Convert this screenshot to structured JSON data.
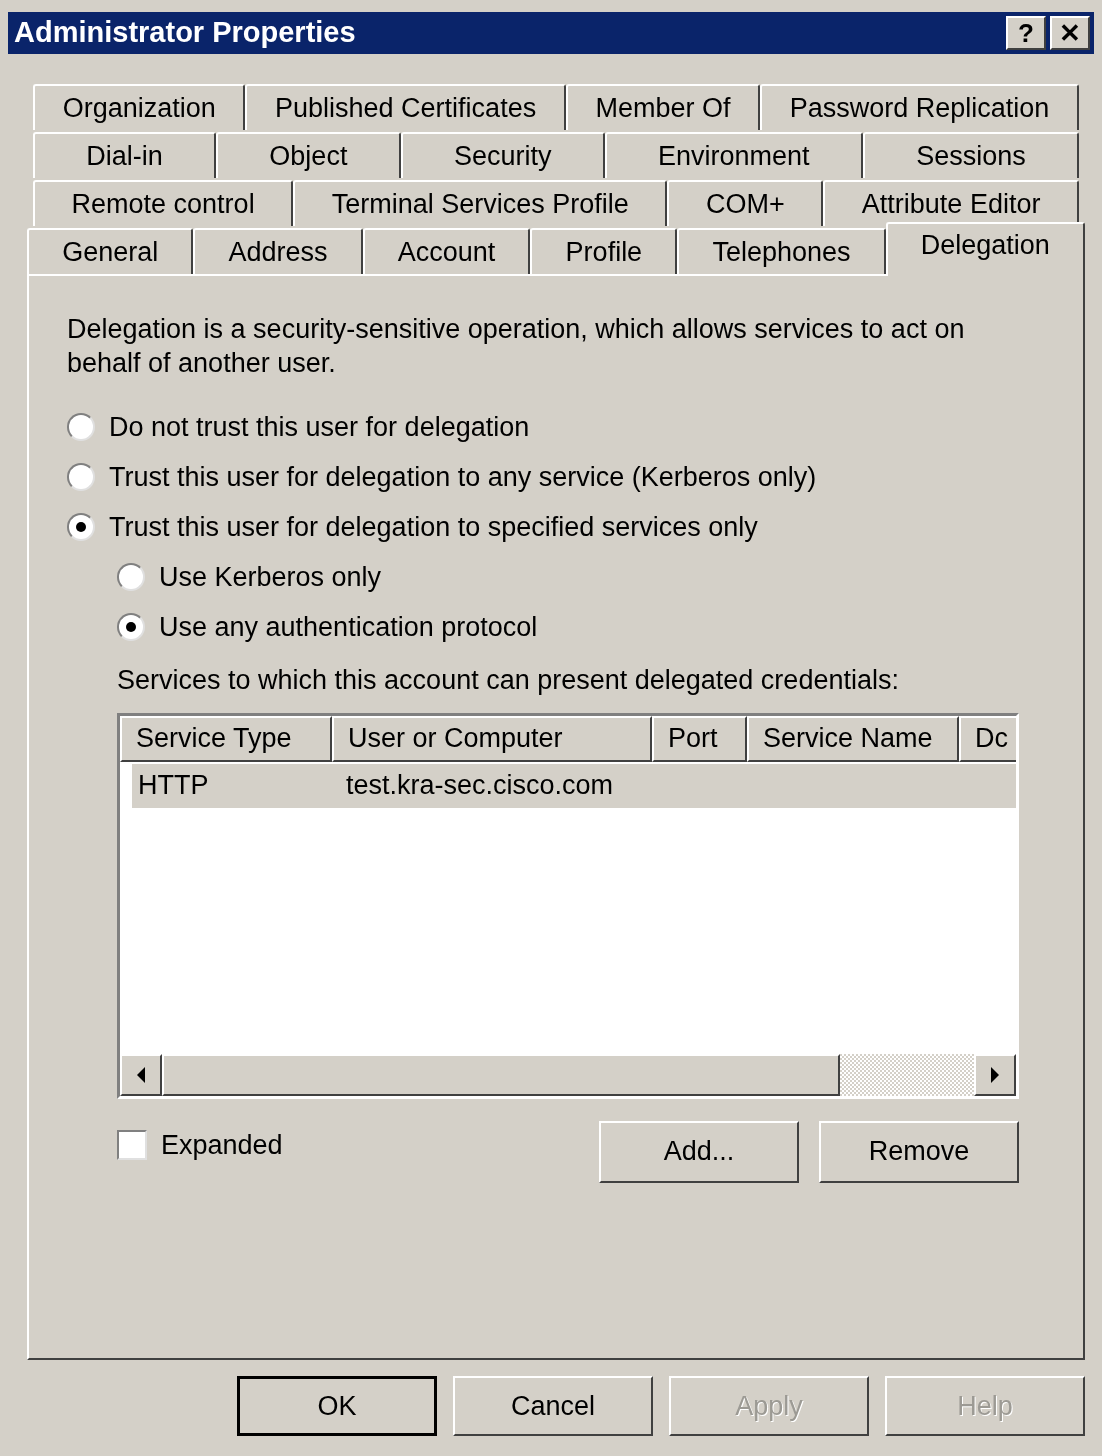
{
  "window": {
    "title": "Administrator Properties",
    "controls": [
      "?",
      "✕"
    ]
  },
  "tab_rows": [
    [
      {
        "label": "Organization",
        "selected": false
      },
      {
        "label": "Published Certificates",
        "selected": false
      },
      {
        "label": "Member Of",
        "selected": false
      },
      {
        "label": "Password Replication",
        "selected": false
      }
    ],
    [
      {
        "label": "Dial-in",
        "selected": false
      },
      {
        "label": "Object",
        "selected": false
      },
      {
        "label": "Security",
        "selected": false
      },
      {
        "label": "Environment",
        "selected": false
      },
      {
        "label": "Sessions",
        "selected": false
      }
    ],
    [
      {
        "label": "Remote control",
        "selected": false
      },
      {
        "label": "Terminal Services Profile",
        "selected": false
      },
      {
        "label": "COM+",
        "selected": false
      },
      {
        "label": "Attribute Editor",
        "selected": false
      }
    ],
    [
      {
        "label": "General",
        "selected": false
      },
      {
        "label": "Address",
        "selected": false
      },
      {
        "label": "Account",
        "selected": false
      },
      {
        "label": "Profile",
        "selected": false
      },
      {
        "label": "Telephones",
        "selected": false
      },
      {
        "label": "Delegation",
        "selected": true
      }
    ]
  ],
  "description": "Delegation is a security-sensitive operation, which allows services to act on behalf of another user.",
  "delegation_options": [
    {
      "label": "Do not trust this user for delegation",
      "selected": false
    },
    {
      "label": "Trust this user for delegation to any service (Kerberos only)",
      "selected": false
    },
    {
      "label": "Trust this user for delegation to specified services only",
      "selected": true,
      "children": [
        {
          "label": "Use Kerberos only",
          "selected": false
        },
        {
          "label": "Use any authentication protocol",
          "selected": true
        }
      ]
    }
  ],
  "services_label": "Services to which this account can present delegated credentials:",
  "table": {
    "columns": [
      "Service Type",
      "User or Computer",
      "Port",
      "Service Name",
      "Dc"
    ],
    "rows": [
      {
        "cells": [
          "HTTP",
          "test.kra-sec.cisco.com"
        ],
        "selected": true
      }
    ]
  },
  "expanded": {
    "label": "Expanded",
    "checked": false
  },
  "list_buttons": [
    {
      "label": "Add...",
      "disabled": false
    },
    {
      "label": "Remove",
      "disabled": false
    }
  ],
  "buttons": [
    {
      "label": "OK",
      "default": true,
      "disabled": false
    },
    {
      "label": "Cancel",
      "default": false,
      "disabled": false
    },
    {
      "label": "Apply",
      "default": false,
      "disabled": true
    },
    {
      "label": "Help",
      "default": false,
      "disabled": true
    }
  ]
}
